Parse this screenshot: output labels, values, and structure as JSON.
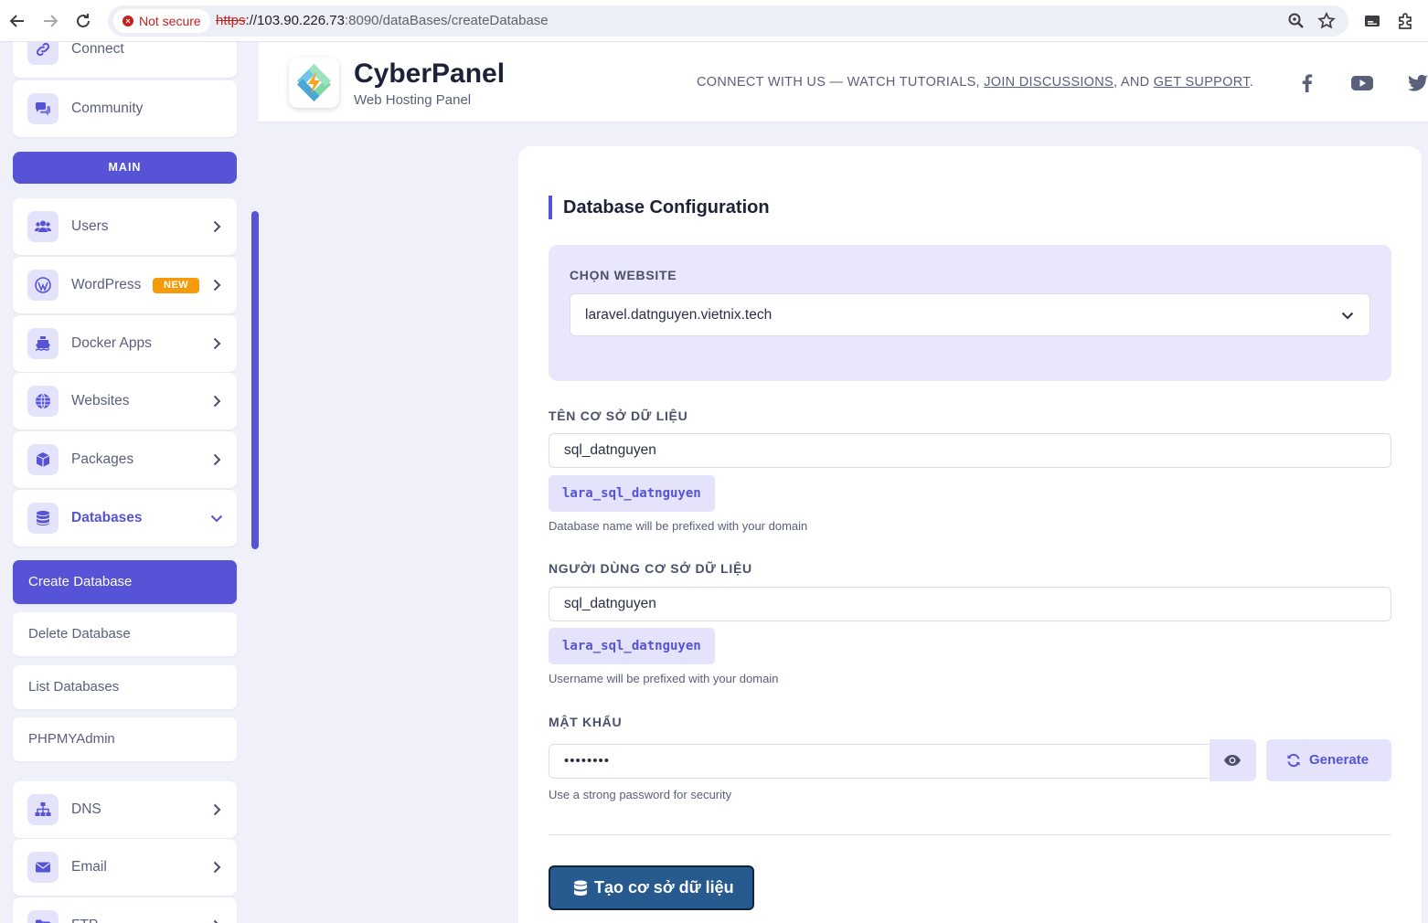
{
  "browser": {
    "security_label": "Not secure",
    "url_scheme": "https",
    "url_host": "://103.90.226.73",
    "url_path": ":8090/dataBases/createDatabase"
  },
  "sidebar": {
    "top_items": [
      {
        "label": "Connect",
        "icon": "link-icon"
      },
      {
        "label": "Community",
        "icon": "comments-icon"
      }
    ],
    "section_label": "MAIN",
    "items": [
      {
        "label": "Users",
        "icon": "users-icon"
      },
      {
        "label": "WordPress",
        "icon": "wordpress-icon",
        "badge": "NEW"
      },
      {
        "label": "Docker Apps",
        "icon": "ship-icon"
      },
      {
        "label": "Websites",
        "icon": "globe-icon"
      },
      {
        "label": "Packages",
        "icon": "box-icon"
      },
      {
        "label": "Databases",
        "icon": "database-icon"
      },
      {
        "label": "DNS",
        "icon": "sitemap-icon"
      },
      {
        "label": "Email",
        "icon": "envelope-icon"
      },
      {
        "label": "FTP",
        "icon": "folder-icon"
      }
    ],
    "database_subitems": [
      "Create Database",
      "Delete Database",
      "List Databases",
      "PHPMYAdmin"
    ],
    "active_subitem": "Create Database"
  },
  "header": {
    "brand_title": "CyberPanel",
    "brand_subtitle": "Web Hosting Panel",
    "connect_prefix": "CONNECT WITH US — WATCH TUTORIALS, ",
    "connect_link1": "JOIN DISCUSSIONS",
    "connect_mid": ", AND ",
    "connect_link2": "GET SUPPORT",
    "connect_suffix": ".",
    "social": [
      "facebook-icon",
      "youtube-icon",
      "twitter-icon"
    ]
  },
  "form": {
    "section_title": "Database Configuration",
    "website_label": "CHỌN WEBSITE",
    "website_value": "laravel.datnguyen.vietnix.tech",
    "db_name_label": "TÊN CƠ SỞ DỮ LIỆU",
    "db_name_value": "sql_datnguyen",
    "db_name_prefixed": "lara_sql_datnguyen",
    "db_name_help": "Database name will be prefixed with your domain",
    "db_user_label": "NGƯỜI DÙNG CƠ SỞ DỮ LIỆU",
    "db_user_value": "sql_datnguyen",
    "db_user_prefixed": "lara_sql_datnguyen",
    "db_user_help": "Username will be prefixed with your domain",
    "password_label": "MẬT KHẨU",
    "password_value": "••••••••",
    "password_help": "Use a strong password for security",
    "generate_label": "Generate",
    "submit_label": "Tạo cơ sở dữ liệu"
  },
  "colors": {
    "accent": "#5753d6",
    "accent_light": "#e4e3fb",
    "submit_bg": "#275b8f",
    "badge_new": "#f59b0b"
  }
}
